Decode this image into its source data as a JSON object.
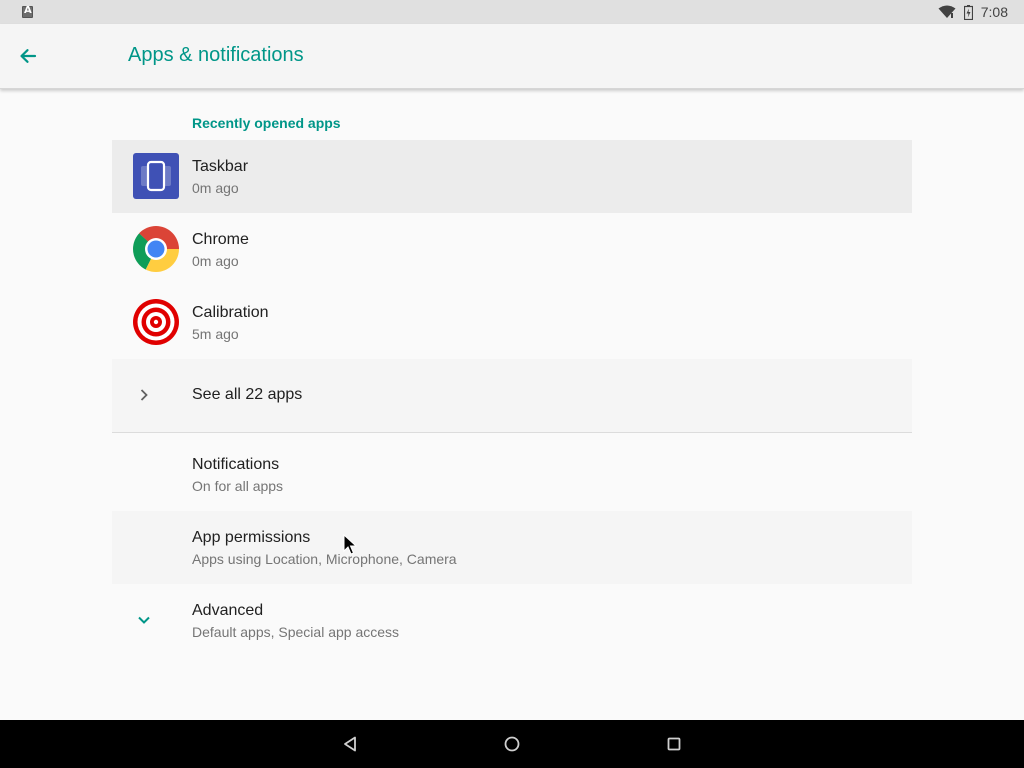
{
  "status_bar": {
    "notification_icon": "a-letter-icon",
    "time": "7:08",
    "icons": [
      "wifi-icon",
      "battery-icon"
    ]
  },
  "app_bar": {
    "title": "Apps & notifications",
    "back_icon": "arrow-back-icon"
  },
  "recent_apps": {
    "header": "Recently opened apps",
    "items": [
      {
        "name": "Taskbar",
        "time": "0m ago",
        "icon": "taskbar-app-icon"
      },
      {
        "name": "Chrome",
        "time": "0m ago",
        "icon": "chrome-app-icon"
      },
      {
        "name": "Calibration",
        "time": "5m ago",
        "icon": "calibration-app-icon"
      }
    ],
    "see_all": "See all 22 apps"
  },
  "settings": [
    {
      "title": "Notifications",
      "subtitle": "On for all apps"
    },
    {
      "title": "App permissions",
      "subtitle": "Apps using Location, Microphone, Camera"
    },
    {
      "title": "Advanced",
      "subtitle": "Default apps, Special app access"
    }
  ],
  "nav_bar": {
    "buttons": [
      "back-triangle-icon",
      "home-circle-icon",
      "recents-square-icon"
    ]
  },
  "colors": {
    "accent": "#009688",
    "status_bar_bg": "#e0e0e0",
    "nav_bar_bg": "#000000",
    "taskbar_icon_bg": "#3f51b5",
    "calibration_red": "#e00000"
  }
}
